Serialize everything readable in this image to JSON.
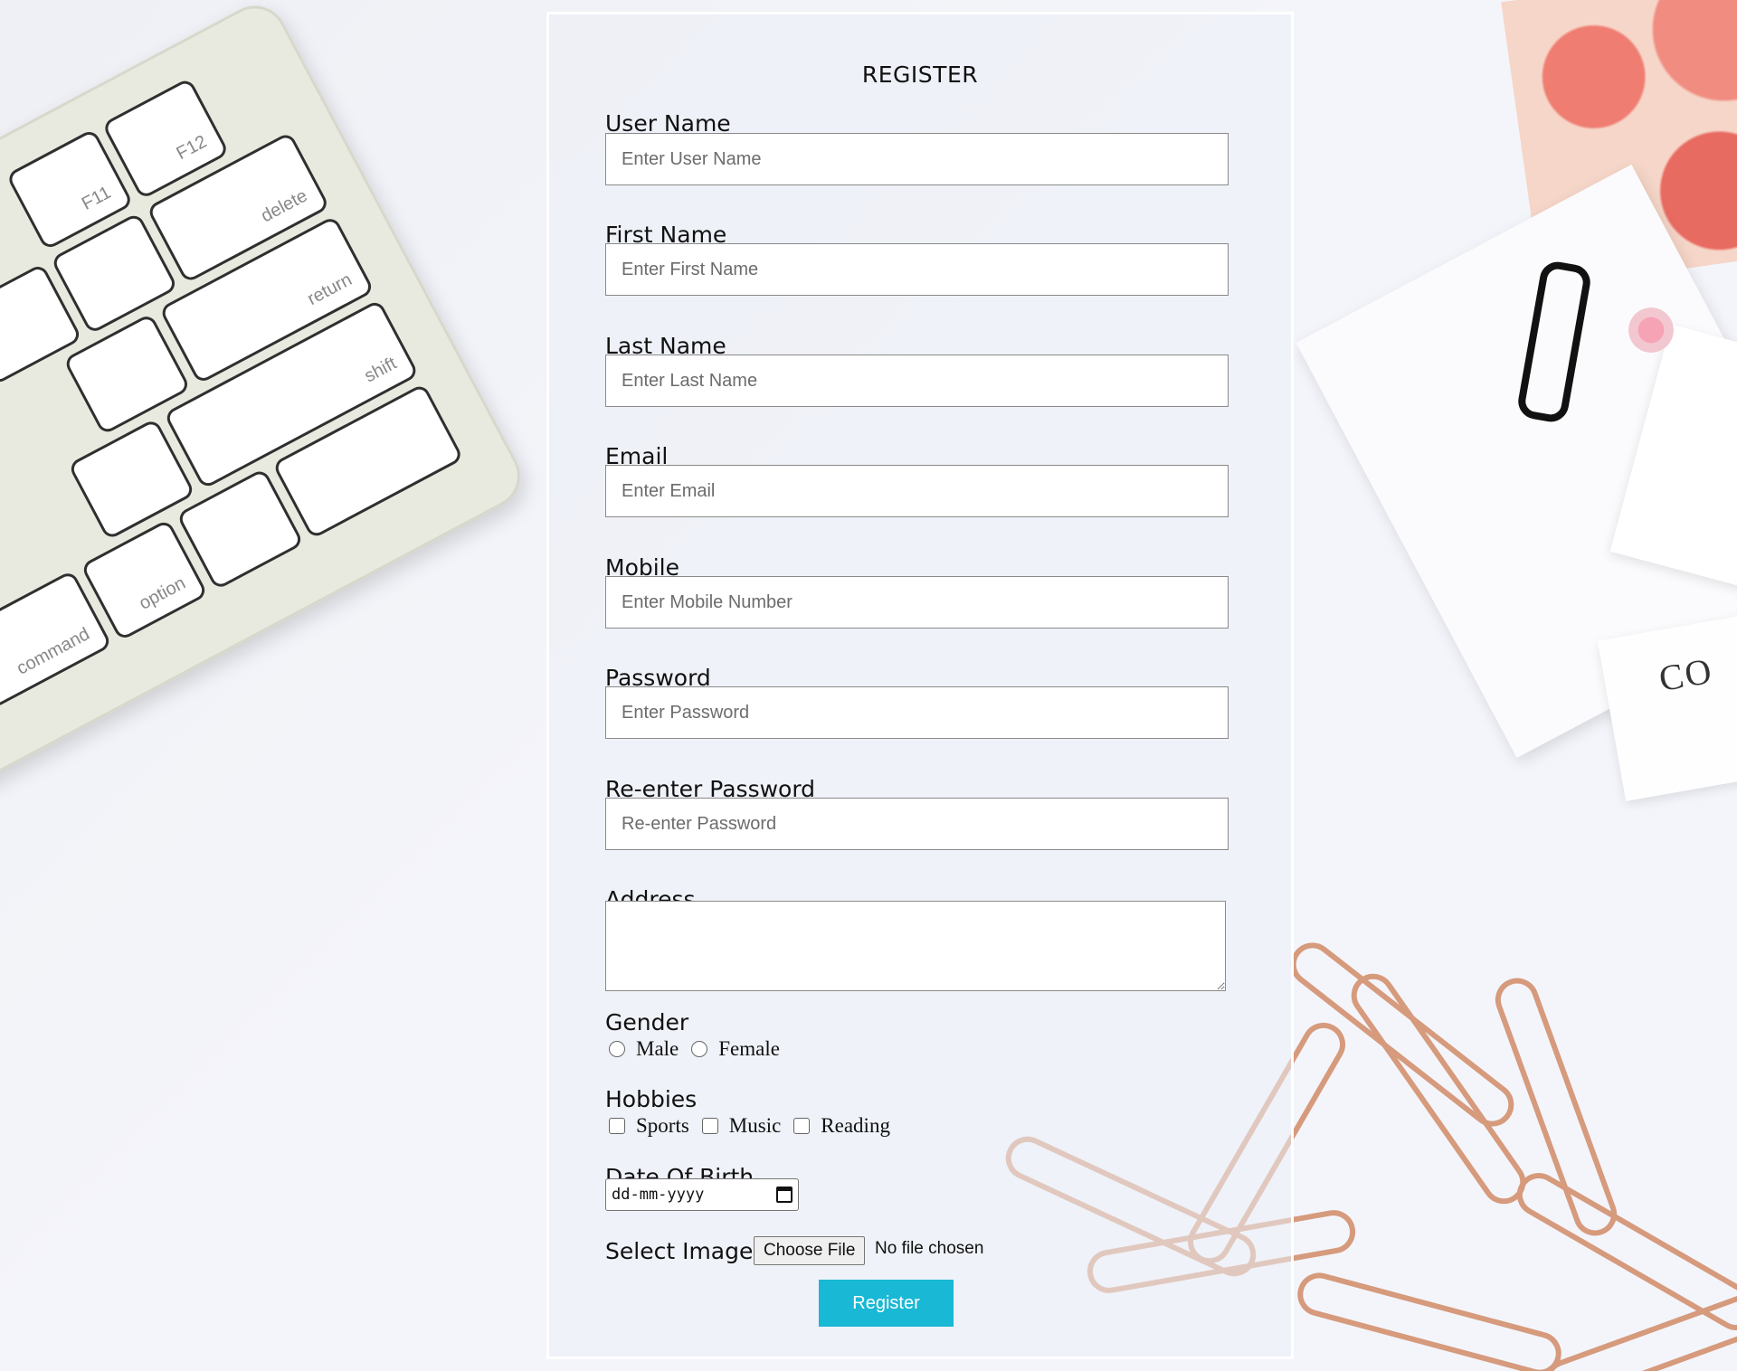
{
  "form": {
    "title": "REGISTER",
    "fields": [
      {
        "label": "User Name",
        "placeholder": "Enter User Name"
      },
      {
        "label": "First Name",
        "placeholder": "Enter First Name"
      },
      {
        "label": "Last Name",
        "placeholder": "Enter Last Name"
      },
      {
        "label": "Email",
        "placeholder": "Enter Email"
      },
      {
        "label": "Mobile",
        "placeholder": "Enter Mobile Number"
      },
      {
        "label": "Password",
        "placeholder": "Enter Password"
      },
      {
        "label": "Re-enter Password",
        "placeholder": "Re-enter Password"
      }
    ],
    "address_label": "Address",
    "gender": {
      "label": "Gender",
      "options": [
        "Male",
        "Female"
      ]
    },
    "hobbies": {
      "label": "Hobbies",
      "options": [
        "Sports",
        "Music",
        "Reading"
      ]
    },
    "dob": {
      "label": "Date Of Birth",
      "placeholder": "dd-mm-yyyy"
    },
    "image": {
      "label": "Select Image",
      "button": "Choose File",
      "status": "No file chosen"
    },
    "submit_label": "Register",
    "accent_color": "#19b8d4"
  },
  "background": {
    "keyboard_keys": [
      "F11",
      "F12",
      "delete",
      "return",
      "shift",
      "option",
      "command"
    ],
    "card_text": "CO"
  }
}
